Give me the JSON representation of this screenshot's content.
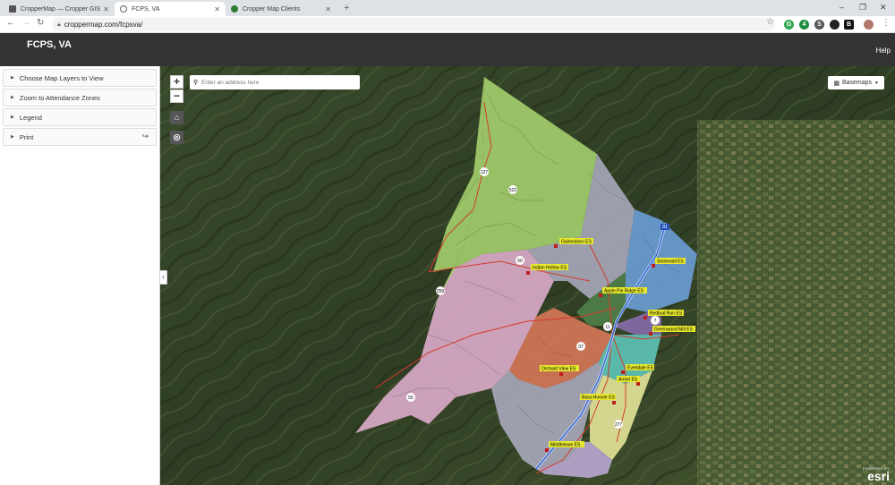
{
  "browser": {
    "tabs": [
      {
        "title": "CropperMap — Cropper GIS",
        "fav_color": "#555555"
      },
      {
        "title": "FCPS, VA",
        "fav_color": "#5f6368"
      },
      {
        "title": "Cropper Map Clients",
        "fav_color": "#2e7d32"
      }
    ],
    "url": "croppermap.com/fcpsva/",
    "window_controls": [
      "–",
      "❐",
      "✕"
    ],
    "extensions": [
      "G",
      "4",
      "S",
      "B"
    ]
  },
  "header": {
    "title": "FCPS, VA",
    "help": "Help"
  },
  "sidebar": {
    "panels": [
      {
        "label": "Choose Map Layers to View"
      },
      {
        "label": "Zoom to Attendance Zones"
      },
      {
        "label": "Legend"
      },
      {
        "label": "Print"
      }
    ]
  },
  "map": {
    "search_placeholder": "Enter an address here",
    "basemaps_label": "Basemaps",
    "attribution_small": "POWERED BY",
    "attribution_logo": "esri",
    "school_labels": [
      "Gainesboro ES",
      "Indian Hollow ES",
      "Apple Pie Ridge ES",
      "Stonewall ES",
      "Redbud Run ES",
      "Greenwood Mill ES",
      "Evendale ES",
      "Orchard View ES",
      "Armel ES",
      "Bass-Hoover ES",
      "Middletown ES"
    ],
    "route_labels": [
      "127",
      "522",
      "50",
      "259",
      "11",
      "37",
      "7",
      "81",
      "55",
      "277"
    ],
    "colors": {
      "zone_green": "#a4cf6d",
      "zone_pink": "#d9a9c7",
      "zone_orange": "#e07a5a",
      "zone_blue": "#6c9fd6",
      "zone_teal": "#5dc4b8",
      "zone_grey": "#a9a9bb",
      "zone_yellow": "#e5e59a",
      "label_bg": "#e8e82e"
    }
  }
}
